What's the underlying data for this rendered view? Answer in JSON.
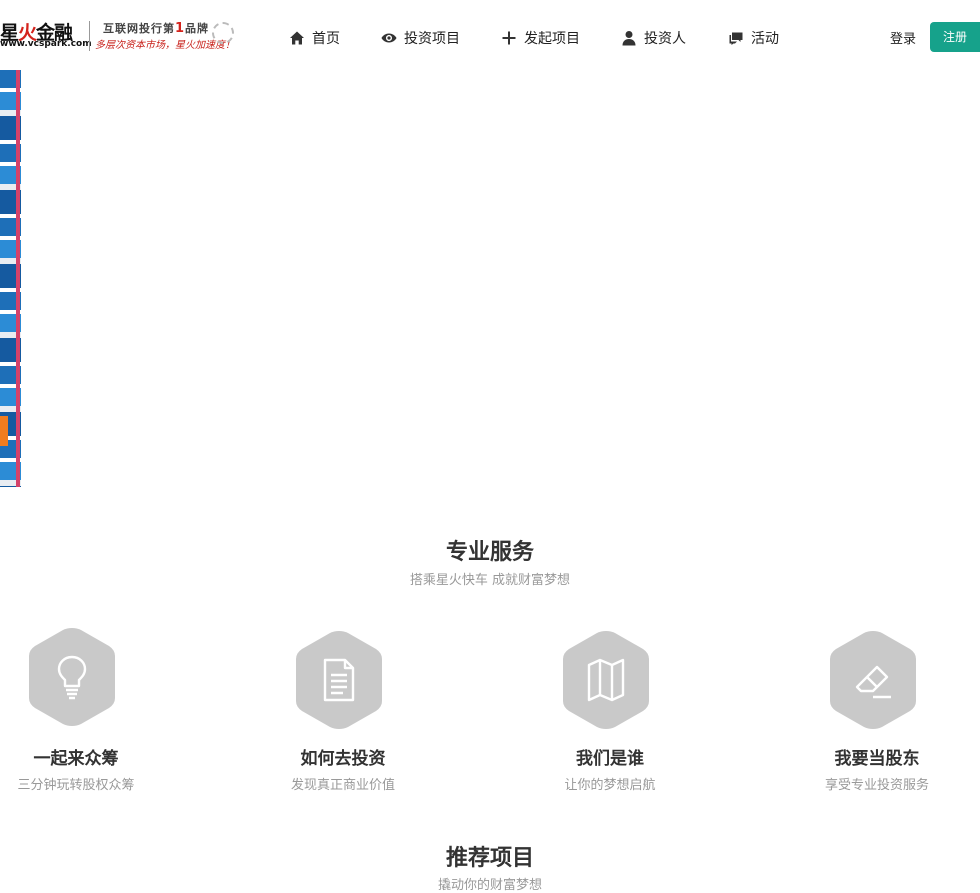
{
  "brand": {
    "name_part1": "星",
    "name_part2": "火",
    "name_part3": "金融",
    "url": "www.vcspark.com",
    "slogan_prefix": "互联网投行第",
    "slogan_num": "1",
    "slogan_suffix": "品牌",
    "tagline": "多层次资本市场，星火加速度！"
  },
  "nav": {
    "home": "首页",
    "invest_projects": "投资项目",
    "launch_project": "发起项目",
    "investors": "投资人",
    "activities": "活动"
  },
  "auth": {
    "login": "登录",
    "register": "注册"
  },
  "colors": {
    "accent": "#16a28b",
    "icon_hex": "#c9c9c9"
  },
  "services_section": {
    "title": "专业服务",
    "subtitle": "搭乘星火快车 成就财富梦想",
    "items": [
      {
        "title": "一起来众筹",
        "subtitle": "三分钟玩转股权众筹",
        "icon": "lightbulb-icon"
      },
      {
        "title": "如何去投资",
        "subtitle": "发现真正商业价值",
        "icon": "document-icon"
      },
      {
        "title": "我们是谁",
        "subtitle": "让你的梦想启航",
        "icon": "map-icon"
      },
      {
        "title": "我要当股东",
        "subtitle": "享受专业投资服务",
        "icon": "eraser-icon"
      }
    ]
  },
  "projects_section": {
    "title": "推荐项目",
    "subtitle": "撬动你的财富梦想"
  }
}
